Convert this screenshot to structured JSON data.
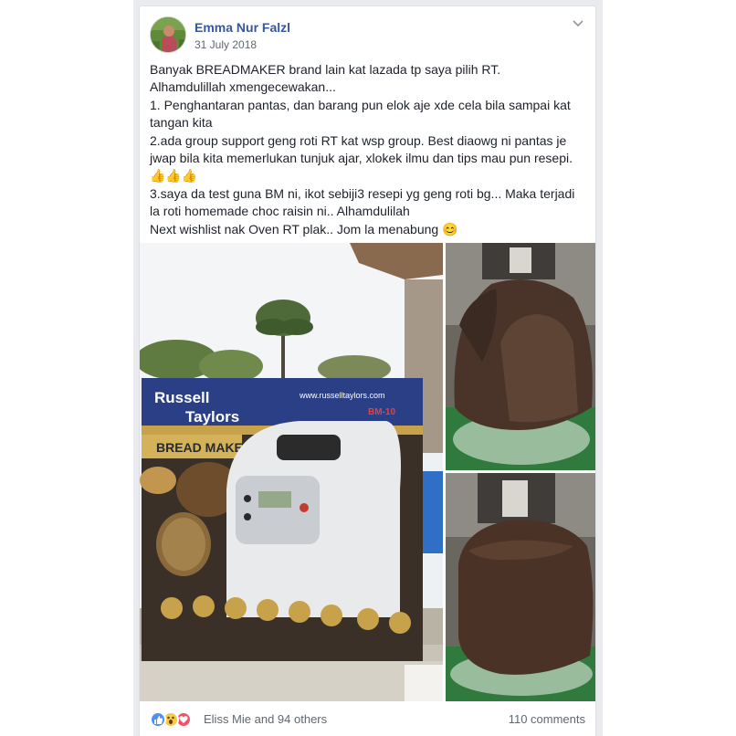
{
  "post": {
    "author": "Emma Nur Falzl",
    "date": "31 July 2018",
    "text_lines": [
      "Banyak BREADMAKER brand lain kat lazada tp saya pilih RT.",
      "Alhamdulillah xmengecewakan...",
      "1. Penghantaran pantas, dan barang pun elok aje xde cela bila sampai kat",
      "tangan kita",
      "2.ada group support geng roti RT kat wsp group. Best diaowg ni pantas je",
      "jwap bila kita memerlukan tunjuk ajar, xlokek ilmu dan tips mau pun resepi.",
      "👍👍👍",
      "3.saya da test guna BM ni, ikot sebiji3 resepi yg geng roti bg... Maka terjadi",
      "la roti homemade choc raisin ni.. Alhamdulilah",
      "Next wishlist nak Oven RT plak.. Jom la menabung 😊"
    ]
  },
  "photo_main": {
    "brand_line1": "Russell",
    "brand_line2": "Taylors",
    "website": "www.russelltaylors.com",
    "model": "BM-10",
    "product": "BREAD MAKER"
  },
  "reactions": {
    "names": "Eliss Mie and 94 others",
    "comments": "110 comments",
    "icons": [
      "like-icon",
      "wow-icon",
      "love-icon"
    ],
    "colors": {
      "like": "#4f8ff7",
      "wow": "#f7c94a",
      "love": "#f25268"
    }
  },
  "colors": {
    "link": "#365899",
    "text": "#1d2129",
    "meta": "#616770",
    "page_bg": "#e9ebee"
  }
}
